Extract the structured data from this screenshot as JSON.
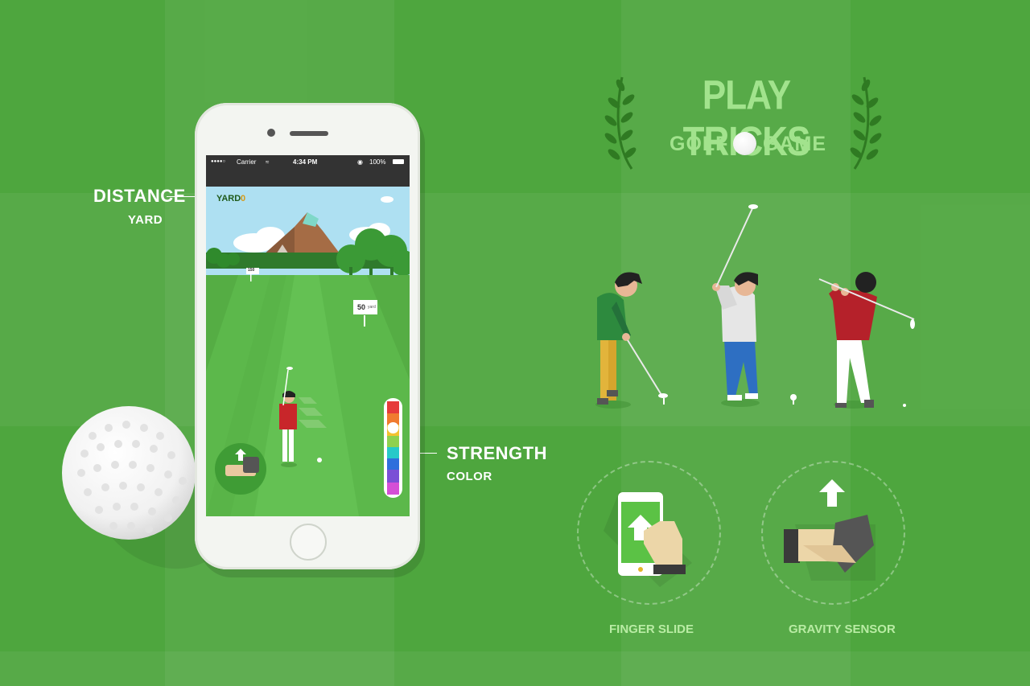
{
  "title": {
    "main": "PLAY TRICKS",
    "sub_left": "GOLF",
    "sub_right": "GAME"
  },
  "annotations": {
    "distance_title": "DISTANCE",
    "distance_unit": "YARD",
    "strength_title": "STRENGTH",
    "strength_unit": "COLOR"
  },
  "phone": {
    "status": {
      "signal": "●●●●○",
      "carrier": "Carrier",
      "time": "4:34 PM",
      "battery": "100%"
    },
    "yard_label": "YARD",
    "yard_value": "0",
    "sign_150": "150",
    "sign_50": "50",
    "sign_yard_small": "yard"
  },
  "controls": {
    "finger_slide": "FINGER SLIDE",
    "gravity_sensor": "GRAVITY SENSOR"
  },
  "colors": {
    "background": "#4ea63e",
    "title_text": "#9fe08a",
    "label_text": "#ffffff",
    "control_label": "#b9eca4"
  }
}
